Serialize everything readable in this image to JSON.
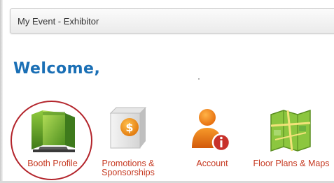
{
  "colors": {
    "link": "#c63a22",
    "welcome": "#1a6fb5",
    "highlight": "#b3242b"
  },
  "header": {
    "title": "My Event - Exhibitor"
  },
  "welcome_text": "Welcome,",
  "tiles": [
    {
      "label": "Booth Profile",
      "icon": "booth-icon",
      "highlighted": true
    },
    {
      "label": "Promotions & Sponsorships",
      "icon": "money-box-icon"
    },
    {
      "label": "Account",
      "icon": "user-info-icon"
    },
    {
      "label": "Floor Plans & Maps",
      "icon": "map-icon"
    }
  ]
}
